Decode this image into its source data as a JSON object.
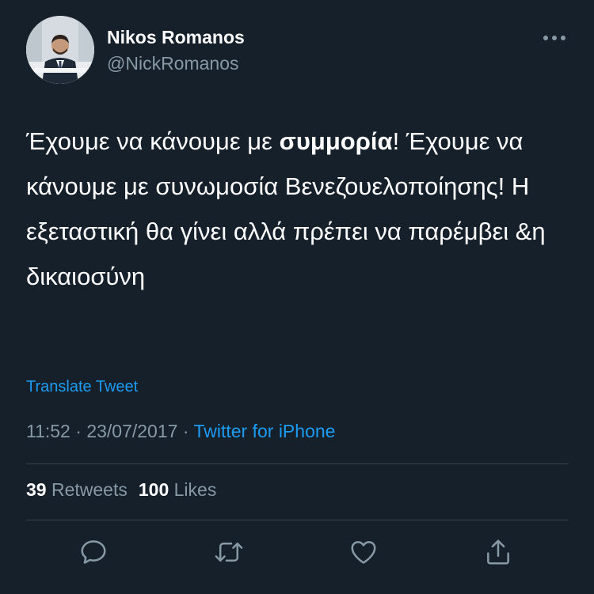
{
  "author": {
    "name": "Nikos Romanos",
    "handle": "@NickRomanos"
  },
  "tweet": {
    "text_part1": "Έχουμε να κάνουμε με ",
    "text_bold": "συμμορία",
    "text_part2": "! Έχουμε να κάνουμε με συνωμοσία Βενεζουελοποίησης! Η εξεταστική θα γίνει αλλά πρέπει να παρέμβει &η δικαιοσύνη"
  },
  "translate_label": "Translate Tweet",
  "meta": {
    "time": "11:52",
    "separator1": " · ",
    "date": "23/07/2017",
    "separator2": " · ",
    "source": "Twitter for iPhone"
  },
  "stats": {
    "retweets_count": "39",
    "retweets_label": "Retweets",
    "likes_count": "100",
    "likes_label": "Likes"
  },
  "icons": {
    "more": "more-dots-icon",
    "reply": "reply-icon",
    "retweet": "retweet-icon",
    "like": "like-icon",
    "share": "share-icon"
  },
  "colors": {
    "background": "#15202b",
    "accent": "#1d9bf0",
    "secondary_text": "#8899a6",
    "divider": "#38444d"
  }
}
